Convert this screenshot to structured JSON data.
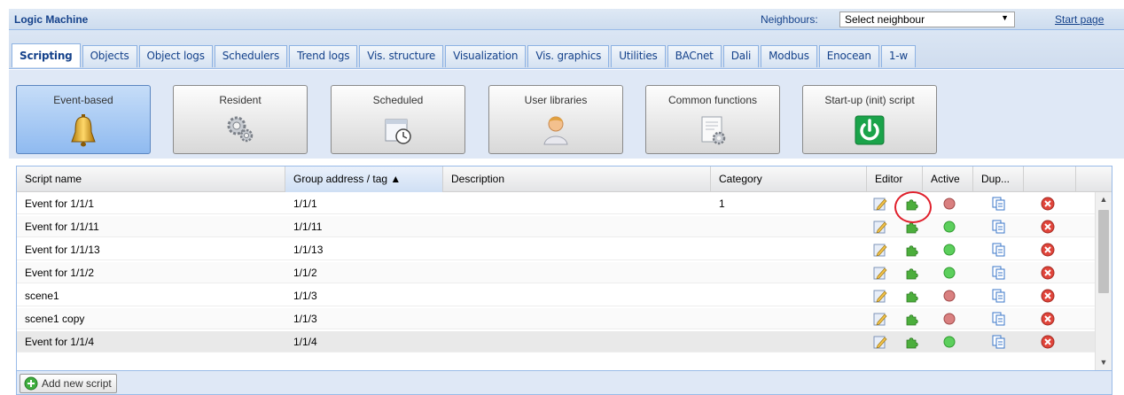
{
  "app": {
    "title": "Logic Machine",
    "neighbours_label": "Neighbours:",
    "neighbours_value": "Select neighbour",
    "start_page": "Start page"
  },
  "tabs": [
    {
      "label": "Scripting",
      "active": true
    },
    {
      "label": "Objects"
    },
    {
      "label": "Object logs"
    },
    {
      "label": "Schedulers"
    },
    {
      "label": "Trend logs"
    },
    {
      "label": "Vis. structure"
    },
    {
      "label": "Visualization"
    },
    {
      "label": "Vis. graphics"
    },
    {
      "label": "Utilities"
    },
    {
      "label": "BACnet"
    },
    {
      "label": "Dali"
    },
    {
      "label": "Modbus"
    },
    {
      "label": "Enocean"
    },
    {
      "label": "1-w"
    }
  ],
  "script_types": [
    {
      "label": "Event-based",
      "icon": "bell-icon",
      "active": true
    },
    {
      "label": "Resident",
      "icon": "gears-icon"
    },
    {
      "label": "Scheduled",
      "icon": "calendar-clock-icon"
    },
    {
      "label": "User libraries",
      "icon": "user-icon"
    },
    {
      "label": "Common functions",
      "icon": "document-gear-icon"
    },
    {
      "label": "Start-up (init) script",
      "icon": "power-icon"
    }
  ],
  "grid": {
    "columns": {
      "name": "Script name",
      "group": "Group address / tag ▲",
      "description": "Description",
      "category": "Category",
      "editor": "Editor",
      "active": "Active",
      "duplicate": "Dup..."
    },
    "rows": [
      {
        "name": "Event for 1/1/1",
        "group": "1/1/1",
        "description": "",
        "category": "1",
        "active": false
      },
      {
        "name": "Event for 1/1/11",
        "group": "1/1/11",
        "description": "",
        "category": "",
        "active": true
      },
      {
        "name": "Event for 1/1/13",
        "group": "1/1/13",
        "description": "",
        "category": "",
        "active": true
      },
      {
        "name": "Event for 1/1/2",
        "group": "1/1/2",
        "description": "",
        "category": "",
        "active": true
      },
      {
        "name": "scene1",
        "group": "1/1/3",
        "description": "",
        "category": "",
        "active": false
      },
      {
        "name": "scene1 copy",
        "group": "1/1/3",
        "description": "",
        "category": "",
        "active": false
      },
      {
        "name": "Event for 1/1/4",
        "group": "1/1/4",
        "description": "",
        "category": "",
        "active": true
      }
    ]
  },
  "footer": {
    "add_label": "Add new script"
  },
  "colors": {
    "active_on": "#5ccf5c",
    "active_off": "#d98080",
    "accent": "#15428b"
  }
}
